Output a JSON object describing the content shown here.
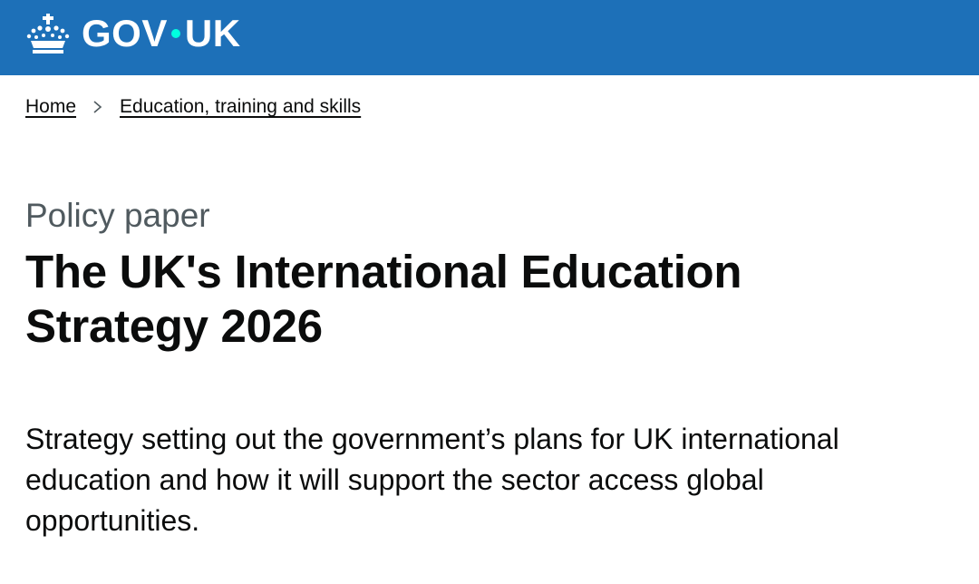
{
  "header": {
    "brand_left": "GOV",
    "brand_right": "UK",
    "dot_color": "#00ffe0",
    "background_color": "#1d70b8",
    "logo_icon": "crown-icon"
  },
  "breadcrumb": {
    "items": [
      {
        "label": "Home"
      },
      {
        "label": "Education, training and skills"
      }
    ],
    "separator_icon": "chevron-right-icon"
  },
  "main": {
    "caption": "Policy paper",
    "title": "The UK's International Education Strategy 2026",
    "description": "Strategy setting out the government’s plans for UK international education and how it will support the sector access global opportunities."
  }
}
